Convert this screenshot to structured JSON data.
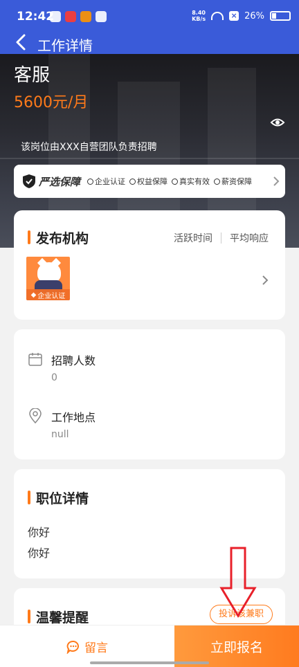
{
  "status_bar": {
    "time": "12:42",
    "net_speed_value": "8.40",
    "net_speed_unit": "KB/s",
    "battery": "26%"
  },
  "header": {
    "title": "工作详情"
  },
  "job": {
    "title": "客服",
    "salary": "5600元/月",
    "notice": "该岗位由XXX自营团队负责招聘"
  },
  "guarantee": {
    "title": "严选保障",
    "items": [
      "企业认证",
      "权益保障",
      "真实有效",
      "薪资保障"
    ]
  },
  "organization": {
    "section_title": "发布机构",
    "active_time_label": "活跃时间",
    "avg_response_label": "平均响应",
    "cert_badge": "企业认证"
  },
  "info": {
    "headcount_label": "招聘人数",
    "headcount_value": "0",
    "location_label": "工作地点",
    "location_value": "null"
  },
  "detail": {
    "section_title": "职位详情",
    "lines": [
      "你好",
      "你好"
    ]
  },
  "tips": {
    "section_title": "温馨提醒",
    "complaint_button": "投诉该兼职"
  },
  "bottom_bar": {
    "message_label": "留言",
    "apply_label": "立即报名"
  },
  "colors": {
    "header_blue": "#3a5bd9",
    "accent_orange": "#ff7a1a",
    "arrow_red": "#e8202a"
  },
  "icons": [
    "back-icon",
    "eye-icon",
    "shield-icon",
    "chevron-right-icon",
    "calendar-icon",
    "location-pin-icon",
    "chat-icon"
  ]
}
